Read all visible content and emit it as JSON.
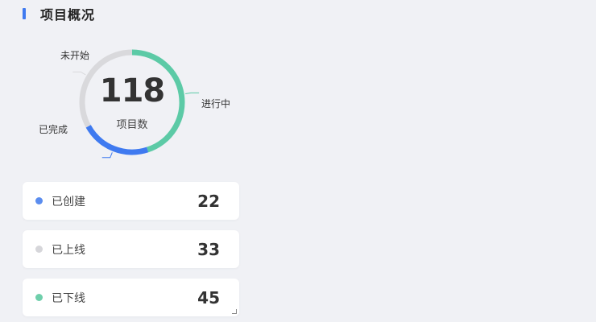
{
  "header": {
    "title": "项目概况"
  },
  "summary": {
    "total": "118",
    "total_label": "项目数"
  },
  "chart_data": {
    "type": "pie",
    "variant": "donut",
    "slices": [
      {
        "label": "进行中",
        "value": 45,
        "color": "#5ccaa6"
      },
      {
        "label": "已完成",
        "value": 22,
        "color": "#3f7af0"
      },
      {
        "label": "未开始",
        "value": 33,
        "color": "#d9d9dc"
      }
    ],
    "center_value": "118",
    "center_label": "项目数"
  },
  "stats": [
    {
      "label": "已创建",
      "value": "22",
      "color": "#5b8def"
    },
    {
      "label": "已上线",
      "value": "33",
      "color": "#d6d6da"
    },
    {
      "label": "已下线",
      "value": "45",
      "color": "#6fcfab"
    }
  ]
}
